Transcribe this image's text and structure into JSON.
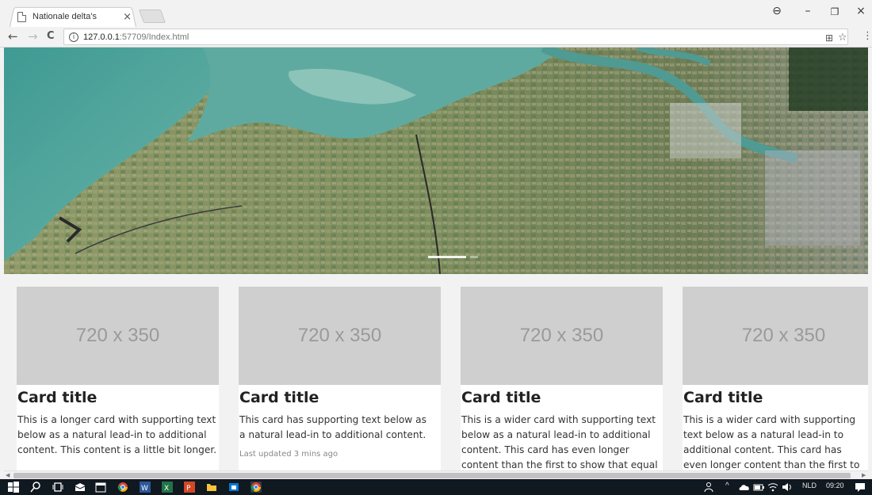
{
  "browser": {
    "tab_title": "Nationale delta's",
    "tab_close": "×",
    "url_host": "127.0.0.1",
    "url_rest": ":57709/Index.html",
    "back": "←",
    "forward": "→",
    "reload": "C",
    "info": "i",
    "translate": "⊞",
    "star": "☆",
    "menu": "⋮",
    "profile": "⊖",
    "minimize": "–",
    "restore": "❐",
    "close": "×"
  },
  "cards": [
    {
      "image_label": "720 x 350",
      "title": "Card title",
      "text": "This is a longer card with supporting text below as a natural lead-in to additional content. This content is a little bit longer.",
      "updated": ""
    },
    {
      "image_label": "720 x 350",
      "title": "Card title",
      "text": "This card has supporting text below as a natural lead-in to additional content.",
      "updated": "Last updated 3 mins ago"
    },
    {
      "image_label": "720 x 350",
      "title": "Card title",
      "text": "This is a wider card with supporting text below as a natural lead-in to additional content. This card has even longer content than the first to show that equal height",
      "updated": ""
    },
    {
      "image_label": "720 x 350",
      "title": "Card title",
      "text": "This is a wider card with supporting text below as a natural lead-in to additional content. This card has even longer content than the first to show that equal height",
      "updated": ""
    }
  ],
  "taskbar": {
    "language": "NLD",
    "time": "09:20"
  },
  "colors": {
    "water": "#5fa9a0",
    "land": "#8a9a6a",
    "taskbar": "#101820"
  }
}
